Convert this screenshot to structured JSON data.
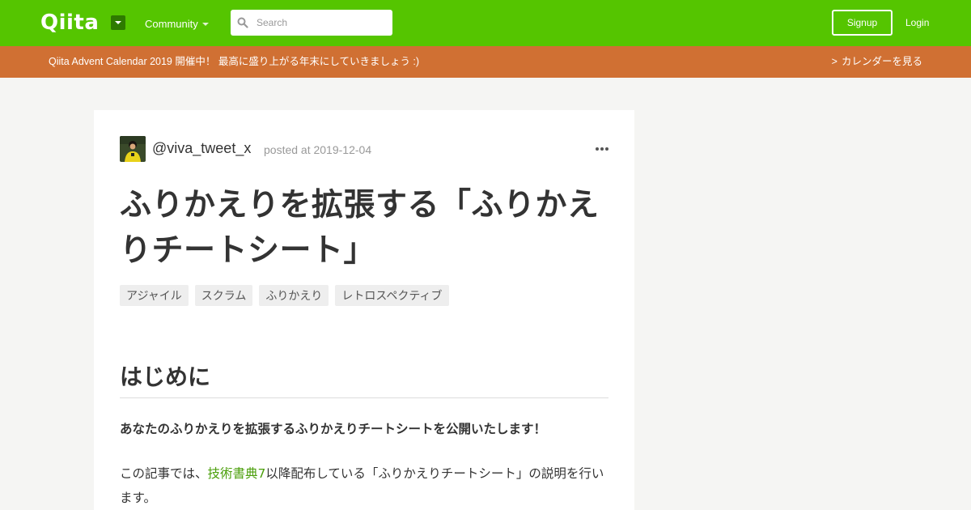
{
  "header": {
    "logo": "Qiita",
    "community_label": "Community",
    "search_placeholder": "Search",
    "signup_label": "Signup",
    "login_label": "Login"
  },
  "banner": {
    "text": "Qiita Advent Calendar 2019 開催中！ 最高に盛り上がる年末にしていきましょう :)",
    "chevron": ">",
    "link_label": "カレンダーを見る"
  },
  "article": {
    "author": "@viva_tweet_x",
    "posted": "posted at 2019-12-04",
    "title": "ふりかえりを拡張する「ふりかえりチートシート」",
    "tags": [
      "アジャイル",
      "スクラム",
      "ふりかえり",
      "レトロスペクティブ"
    ],
    "section_heading": "はじめに",
    "lead": "あなたのふりかえりを拡張するふりかえりチートシートを公開いたします！",
    "para_before_link": "この記事では、",
    "para_link": "技術書典7",
    "para_after_link": "以降配布している「ふりかえりチートシート」の説明を行います。"
  },
  "colors": {
    "brand_green": "#55c500",
    "banner_orange": "#d07033",
    "link_green": "#4b9f0b"
  },
  "icons": [
    "logo-dropdown-icon",
    "caret-down-icon",
    "search-icon",
    "more-dots-icon"
  ]
}
